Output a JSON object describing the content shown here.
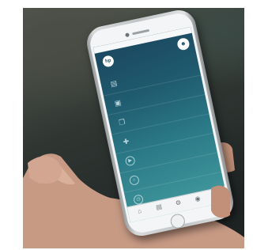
{
  "app": {
    "header_title": ""
  },
  "status_bar": {
    "signal": "",
    "time": "",
    "battery": ""
  },
  "icons": {
    "hp_logo": "hp",
    "profile": "person-icon",
    "menu": [
      "printer-icon",
      "scanner-icon",
      "copy-icon",
      "plus-icon",
      "play-icon",
      "circle-icon",
      "clock-icon"
    ],
    "tabs": [
      "home-icon",
      "printer-icon",
      "gear-icon",
      "help-icon",
      "info-icon"
    ]
  },
  "colors": {
    "screen_gradient": [
      "#1b4660",
      "#2b7a88",
      "#4a9ca0"
    ],
    "phone_frame": "#d8dadb",
    "tab_bar": "#f2f4f5"
  },
  "menu": [
    "",
    "",
    "",
    "",
    "",
    "",
    ""
  ],
  "tabs": [
    "",
    "",
    "",
    "",
    ""
  ]
}
